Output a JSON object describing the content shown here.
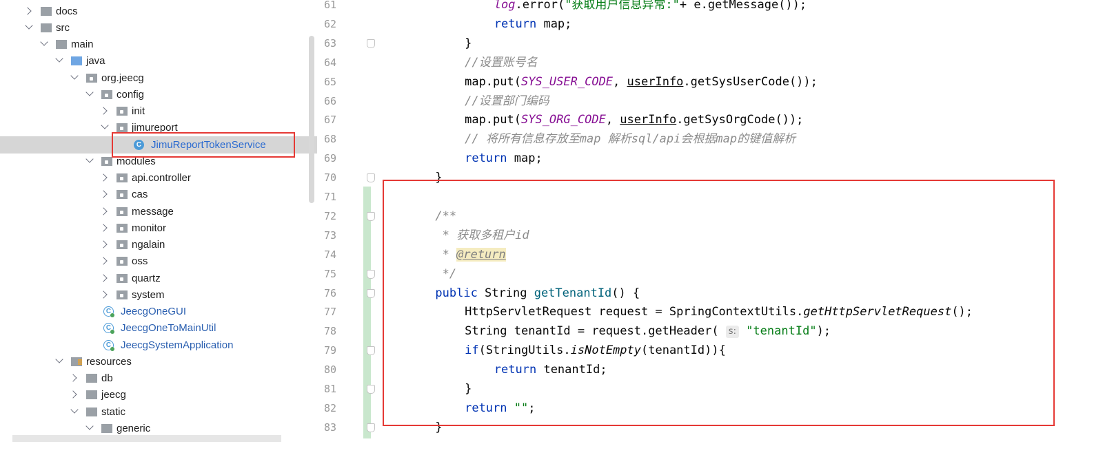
{
  "tree": {
    "items": [
      {
        "label": "docs",
        "depth": 0,
        "state": "collapsed",
        "icon": "folder-icon",
        "kind": "folder"
      },
      {
        "label": "src",
        "depth": 0,
        "state": "expanded",
        "icon": "folder-icon",
        "kind": "folder"
      },
      {
        "label": "main",
        "depth": 1,
        "state": "expanded",
        "icon": "folder-icon",
        "kind": "folder"
      },
      {
        "label": "java",
        "depth": 2,
        "state": "expanded",
        "icon": "source-folder-icon",
        "kind": "source"
      },
      {
        "label": "org.jeecg",
        "depth": 3,
        "state": "expanded",
        "icon": "package-icon",
        "kind": "package"
      },
      {
        "label": "config",
        "depth": 4,
        "state": "expanded",
        "icon": "package-icon",
        "kind": "package"
      },
      {
        "label": "init",
        "depth": 5,
        "state": "collapsed",
        "icon": "package-icon",
        "kind": "package"
      },
      {
        "label": "jimureport",
        "depth": 5,
        "state": "expanded",
        "icon": "package-icon",
        "kind": "package"
      },
      {
        "label": "JimuReportTokenService",
        "depth": 6,
        "state": "leaf",
        "icon": "class-icon",
        "kind": "class",
        "selected": true
      },
      {
        "label": "modules",
        "depth": 4,
        "state": "expanded",
        "icon": "package-icon",
        "kind": "package"
      },
      {
        "label": "api.controller",
        "depth": 5,
        "state": "collapsed",
        "icon": "package-icon",
        "kind": "package"
      },
      {
        "label": "cas",
        "depth": 5,
        "state": "collapsed",
        "icon": "package-icon",
        "kind": "package"
      },
      {
        "label": "message",
        "depth": 5,
        "state": "collapsed",
        "icon": "package-icon",
        "kind": "package"
      },
      {
        "label": "monitor",
        "depth": 5,
        "state": "collapsed",
        "icon": "package-icon",
        "kind": "package"
      },
      {
        "label": "ngalain",
        "depth": 5,
        "state": "collapsed",
        "icon": "package-icon",
        "kind": "package"
      },
      {
        "label": "oss",
        "depth": 5,
        "state": "collapsed",
        "icon": "package-icon",
        "kind": "package"
      },
      {
        "label": "quartz",
        "depth": 5,
        "state": "collapsed",
        "icon": "package-icon",
        "kind": "package"
      },
      {
        "label": "system",
        "depth": 5,
        "state": "collapsed",
        "icon": "package-icon",
        "kind": "package"
      },
      {
        "label": "JeecgOneGUI",
        "depth": 4,
        "state": "leaf",
        "icon": "runnable-class-icon",
        "kind": "runclass"
      },
      {
        "label": "JeecgOneToMainUtil",
        "depth": 4,
        "state": "leaf",
        "icon": "runnable-class-icon",
        "kind": "runclass"
      },
      {
        "label": "JeecgSystemApplication",
        "depth": 4,
        "state": "leaf",
        "icon": "spring-boot-class-icon",
        "kind": "runclass"
      },
      {
        "label": "resources",
        "depth": 2,
        "state": "expanded",
        "icon": "resources-folder-icon",
        "kind": "resources"
      },
      {
        "label": "db",
        "depth": 3,
        "state": "collapsed",
        "icon": "folder-icon",
        "kind": "folder"
      },
      {
        "label": "jeecg",
        "depth": 3,
        "state": "collapsed",
        "icon": "folder-icon",
        "kind": "folder"
      },
      {
        "label": "static",
        "depth": 3,
        "state": "expanded",
        "icon": "folder-icon",
        "kind": "folder"
      },
      {
        "label": "generic",
        "depth": 4,
        "state": "expanded",
        "icon": "folder-icon",
        "kind": "folder"
      }
    ]
  },
  "editor": {
    "lines": [
      {
        "num": "61",
        "indent": 4,
        "tokens": [
          [
            "err",
            "log"
          ],
          [
            "",
            "."
          ],
          [
            "",
            "error("
          ],
          [
            "str",
            "\"获取用户信息异常:\""
          ],
          [
            "",
            "+ e.getMessage());"
          ]
        ]
      },
      {
        "num": "62",
        "indent": 4,
        "tokens": [
          [
            "kw",
            "return"
          ],
          [
            "",
            " map;"
          ]
        ]
      },
      {
        "num": "63",
        "indent": 3,
        "tokens": [
          [
            "",
            "}"
          ]
        ]
      },
      {
        "num": "64",
        "indent": 3,
        "tokens": [
          [
            "cmt",
            "//设置账号名"
          ]
        ]
      },
      {
        "num": "65",
        "indent": 3,
        "tokens": [
          [
            "",
            "map.put("
          ],
          [
            "cn",
            "SYS_USER_CODE"
          ],
          [
            "",
            ", "
          ],
          [
            "ul",
            "userInfo"
          ],
          [
            "",
            ".getSysUserCode());"
          ]
        ]
      },
      {
        "num": "66",
        "indent": 3,
        "tokens": [
          [
            "cmt",
            "//设置部门编码"
          ]
        ]
      },
      {
        "num": "67",
        "indent": 3,
        "tokens": [
          [
            "",
            "map.put("
          ],
          [
            "cn",
            "SYS_ORG_CODE"
          ],
          [
            "",
            ", "
          ],
          [
            "ul",
            "userInfo"
          ],
          [
            "",
            ".getSysOrgCode());"
          ]
        ]
      },
      {
        "num": "68",
        "indent": 3,
        "tokens": [
          [
            "cmt",
            "// 将所有信息存放至map 解析sql/api会根据map的键值解析"
          ]
        ]
      },
      {
        "num": "69",
        "indent": 3,
        "tokens": [
          [
            "kw",
            "return"
          ],
          [
            "",
            " map;"
          ]
        ]
      },
      {
        "num": "70",
        "indent": 2,
        "tokens": [
          [
            "",
            "}"
          ]
        ]
      },
      {
        "num": "71",
        "indent": 2,
        "tokens": []
      },
      {
        "num": "72",
        "indent": 2,
        "tokens": [
          [
            "cmt",
            "/**"
          ]
        ]
      },
      {
        "num": "73",
        "indent": 2,
        "tokens": [
          [
            "cmt",
            " * 获取多租户id"
          ]
        ]
      },
      {
        "num": "74",
        "indent": 2,
        "tokens": [
          [
            "cmt",
            " * "
          ],
          [
            "tag",
            "@return"
          ]
        ]
      },
      {
        "num": "75",
        "indent": 2,
        "tokens": [
          [
            "cmt",
            " */"
          ]
        ]
      },
      {
        "num": "76",
        "indent": 2,
        "tokens": [
          [
            "kw",
            "public"
          ],
          [
            "",
            " String "
          ],
          [
            "fn",
            "getTenantId"
          ],
          [
            "",
            "() {"
          ]
        ]
      },
      {
        "num": "77",
        "indent": 3,
        "tokens": [
          [
            "",
            "HttpServletRequest request = SpringContextUtils."
          ],
          [
            "st",
            "getHttpServletRequest"
          ],
          [
            "",
            "();"
          ]
        ]
      },
      {
        "num": "78",
        "indent": 3,
        "tokens": [
          [
            "",
            "String tenantId = request.getHeader( "
          ],
          [
            "hint",
            "s:"
          ],
          [
            "",
            " "
          ],
          [
            "str",
            "\"tenantId\""
          ],
          [
            "",
            ");"
          ]
        ]
      },
      {
        "num": "79",
        "indent": 3,
        "tokens": [
          [
            "kw",
            "if"
          ],
          [
            "",
            "(StringUtils."
          ],
          [
            "st",
            "isNotEmpty"
          ],
          [
            "",
            "(tenantId)){"
          ]
        ]
      },
      {
        "num": "80",
        "indent": 4,
        "tokens": [
          [
            "kw",
            "return"
          ],
          [
            "",
            " tenantId;"
          ]
        ]
      },
      {
        "num": "81",
        "indent": 3,
        "tokens": [
          [
            "",
            "}"
          ]
        ]
      },
      {
        "num": "82",
        "indent": 3,
        "tokens": [
          [
            "kw",
            "return"
          ],
          [
            "",
            " "
          ],
          [
            "str",
            "\"\""
          ],
          [
            "",
            ";"
          ]
        ]
      },
      {
        "num": "83",
        "indent": 2,
        "tokens": [
          [
            "",
            "}"
          ]
        ]
      }
    ]
  },
  "colors": {
    "keyword": "#0033b3",
    "string": "#067d17",
    "comment": "#8c8c8c",
    "constant": "#871094",
    "method": "#00627a",
    "highlight_box": "#e53935",
    "selected_row": "#d6d6d6",
    "vcs_added": "#c9e7cd"
  }
}
